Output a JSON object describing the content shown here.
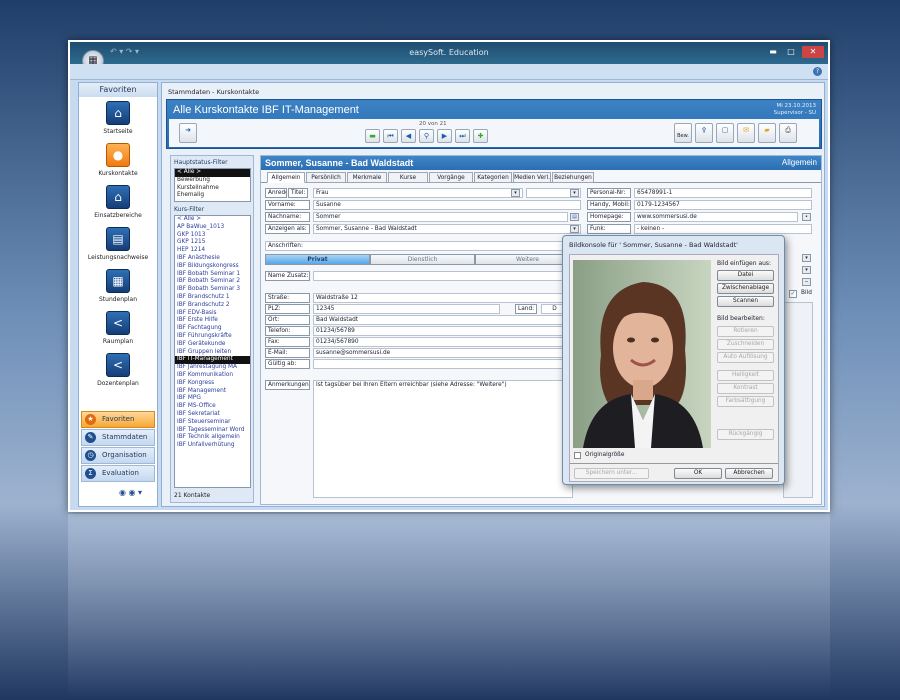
{
  "window": {
    "title": "easySoft. Education",
    "app_button_icon": "office-orb-icon"
  },
  "sidebar": {
    "header": "Favoriten",
    "items": [
      {
        "label": "Startseite",
        "icon": "home-icon"
      },
      {
        "label": "Kurskontakte",
        "icon": "contact-icon"
      },
      {
        "label": "Einsatzbereiche",
        "icon": "building-icon"
      },
      {
        "label": "Leistungsnachweise",
        "icon": "certificate-icon"
      },
      {
        "label": "Stundenplan",
        "icon": "calendar-grid-icon"
      },
      {
        "label": "Raumplan",
        "icon": "share-icon"
      },
      {
        "label": "Dozentenplan",
        "icon": "share-icon"
      }
    ],
    "categories": [
      {
        "label": "Favoriten",
        "icon": "star-icon"
      },
      {
        "label": "Stammdaten",
        "icon": "pencil-icon"
      },
      {
        "label": "Organisation",
        "icon": "clock-icon"
      },
      {
        "label": "Evaluation",
        "icon": "sigma-icon"
      }
    ]
  },
  "main": {
    "breadcrumb": "Stammdaten - Kurskontakte",
    "title": "Alle Kurskontakte IBF IT-Management",
    "date": "Mi 23.10.2013",
    "user": "Supervisor - SU",
    "record_counter": "20 von 21",
    "bew_label": "Bew."
  },
  "filters": {
    "status_title": "Hauptstatus-Filter",
    "status_items": [
      "< Alle >",
      "Bewerbung",
      "Kursteilnahme",
      "Ehemalig"
    ],
    "status_selected": 0,
    "course_title": "Kurs-Filter",
    "course_items": [
      "< Alle >",
      "AP BaWue_1013",
      "GKP 1013",
      "GKP 1215",
      "HEP 1214",
      "IBF Anästhesie",
      "IBF Bildungskongress",
      "IBF Bobath Seminar 1",
      "IBF Bobath Seminar 2",
      "IBF Bobath Seminar 3",
      "IBF Brandschutz 1",
      "IBF Brandschutz 2",
      "IBF EDV-Basis",
      "IBF Erste Hilfe",
      "IBF Fachtagung",
      "IBF Führungskräfte",
      "IBF Gerätekunde",
      "IBF Gruppen leiten",
      "IBF IT-Management",
      "IBF Jahrestagung MA",
      "IBF Kommunikation",
      "IBF Kongress",
      "IBF Management",
      "IBF MPG",
      "IBF MS-Office",
      "IBF Sekretariat",
      "IBF Steuerseminar",
      "IBF Tagesseminar Word",
      "IBF Technik allgemein",
      "IBF Unfallverhütung"
    ],
    "course_selected": 18,
    "count": "21 Kontakte"
  },
  "record": {
    "title": "Sommer, Susanne - Bad Waldstadt",
    "section": "Allgemein",
    "tabs": [
      "Allgemein",
      "Persönlich",
      "Merkmale",
      "Kurse",
      "Vorgänge",
      "Kategorien",
      "Medien Verl.",
      "Beziehungen"
    ],
    "anrede_label": "Anrede:",
    "titel_label": "Titel:",
    "anrede": "Frau",
    "vorname_label": "Vorname:",
    "vorname": "Susanne",
    "nachname_label": "Nachname:",
    "nachname": "Sommer",
    "anzeigen_label": "Anzeigen als:",
    "anzeigen": "Sommer, Susanne - Bad Waldstadt",
    "personal_label": "Personal-Nr:",
    "personal": "65478991-1",
    "handy_label": "Handy, Mobil:",
    "handy": "0179-1234567",
    "homepage_label": "Homepage:",
    "homepage": "www.sommersusi.de",
    "funk_label": "Funk:",
    "funk": "- keinen -",
    "anschriften_label": "Anschriften:",
    "address_tabs": [
      "Privat",
      "Dienstlich",
      "Weitere"
    ],
    "name_zusatz_label": "Name Zusatz:",
    "strasse_label": "Straße:",
    "strasse": "Waldstraße 12",
    "plz_label": "PLZ:",
    "plz": "12345",
    "land_label": "Land:",
    "land": "D",
    "ort_label": "Ort:",
    "ort": "Bad Waldstadt",
    "telefon_label": "Telefon:",
    "telefon": "01234/56789",
    "fax_label": "Fax:",
    "fax": "01234/567890",
    "email_label": "E-Mail:",
    "email": "susanne@sommersusi.de",
    "gueltig_label": "Gültig ab:",
    "anmerkungen_label": "Anmerkungen:",
    "anmerkungen": "Ist tagsüber bei Ihren Eltern erreichbar (siehe Adresse: \"Weitere\")",
    "bild_label": "Bild",
    "bild_checked": true
  },
  "dialog": {
    "title": "Bildkonsole für ' Sommer, Susanne - Bad Waldstadt'",
    "insert_label": "Bild einfügen aus:",
    "insert_buttons": [
      "Datei",
      "Zwischenablage",
      "Scannen"
    ],
    "edit_label": "Bild bearbeiten:",
    "edit_buttons": [
      "Rotieren",
      "Zuschneiden",
      "Auto Auflösung",
      "Helligkeit",
      "Kontrast",
      "Farbsättigung"
    ],
    "undo": "Rückgängig",
    "original_size": "Originalgröße",
    "save_as": "Speichern unter...",
    "ok": "OK",
    "cancel": "Abbrechen"
  },
  "colors": {
    "accent": "#2b6db2",
    "selected_nav": "#f7a834",
    "background": "#1f3f6a"
  }
}
